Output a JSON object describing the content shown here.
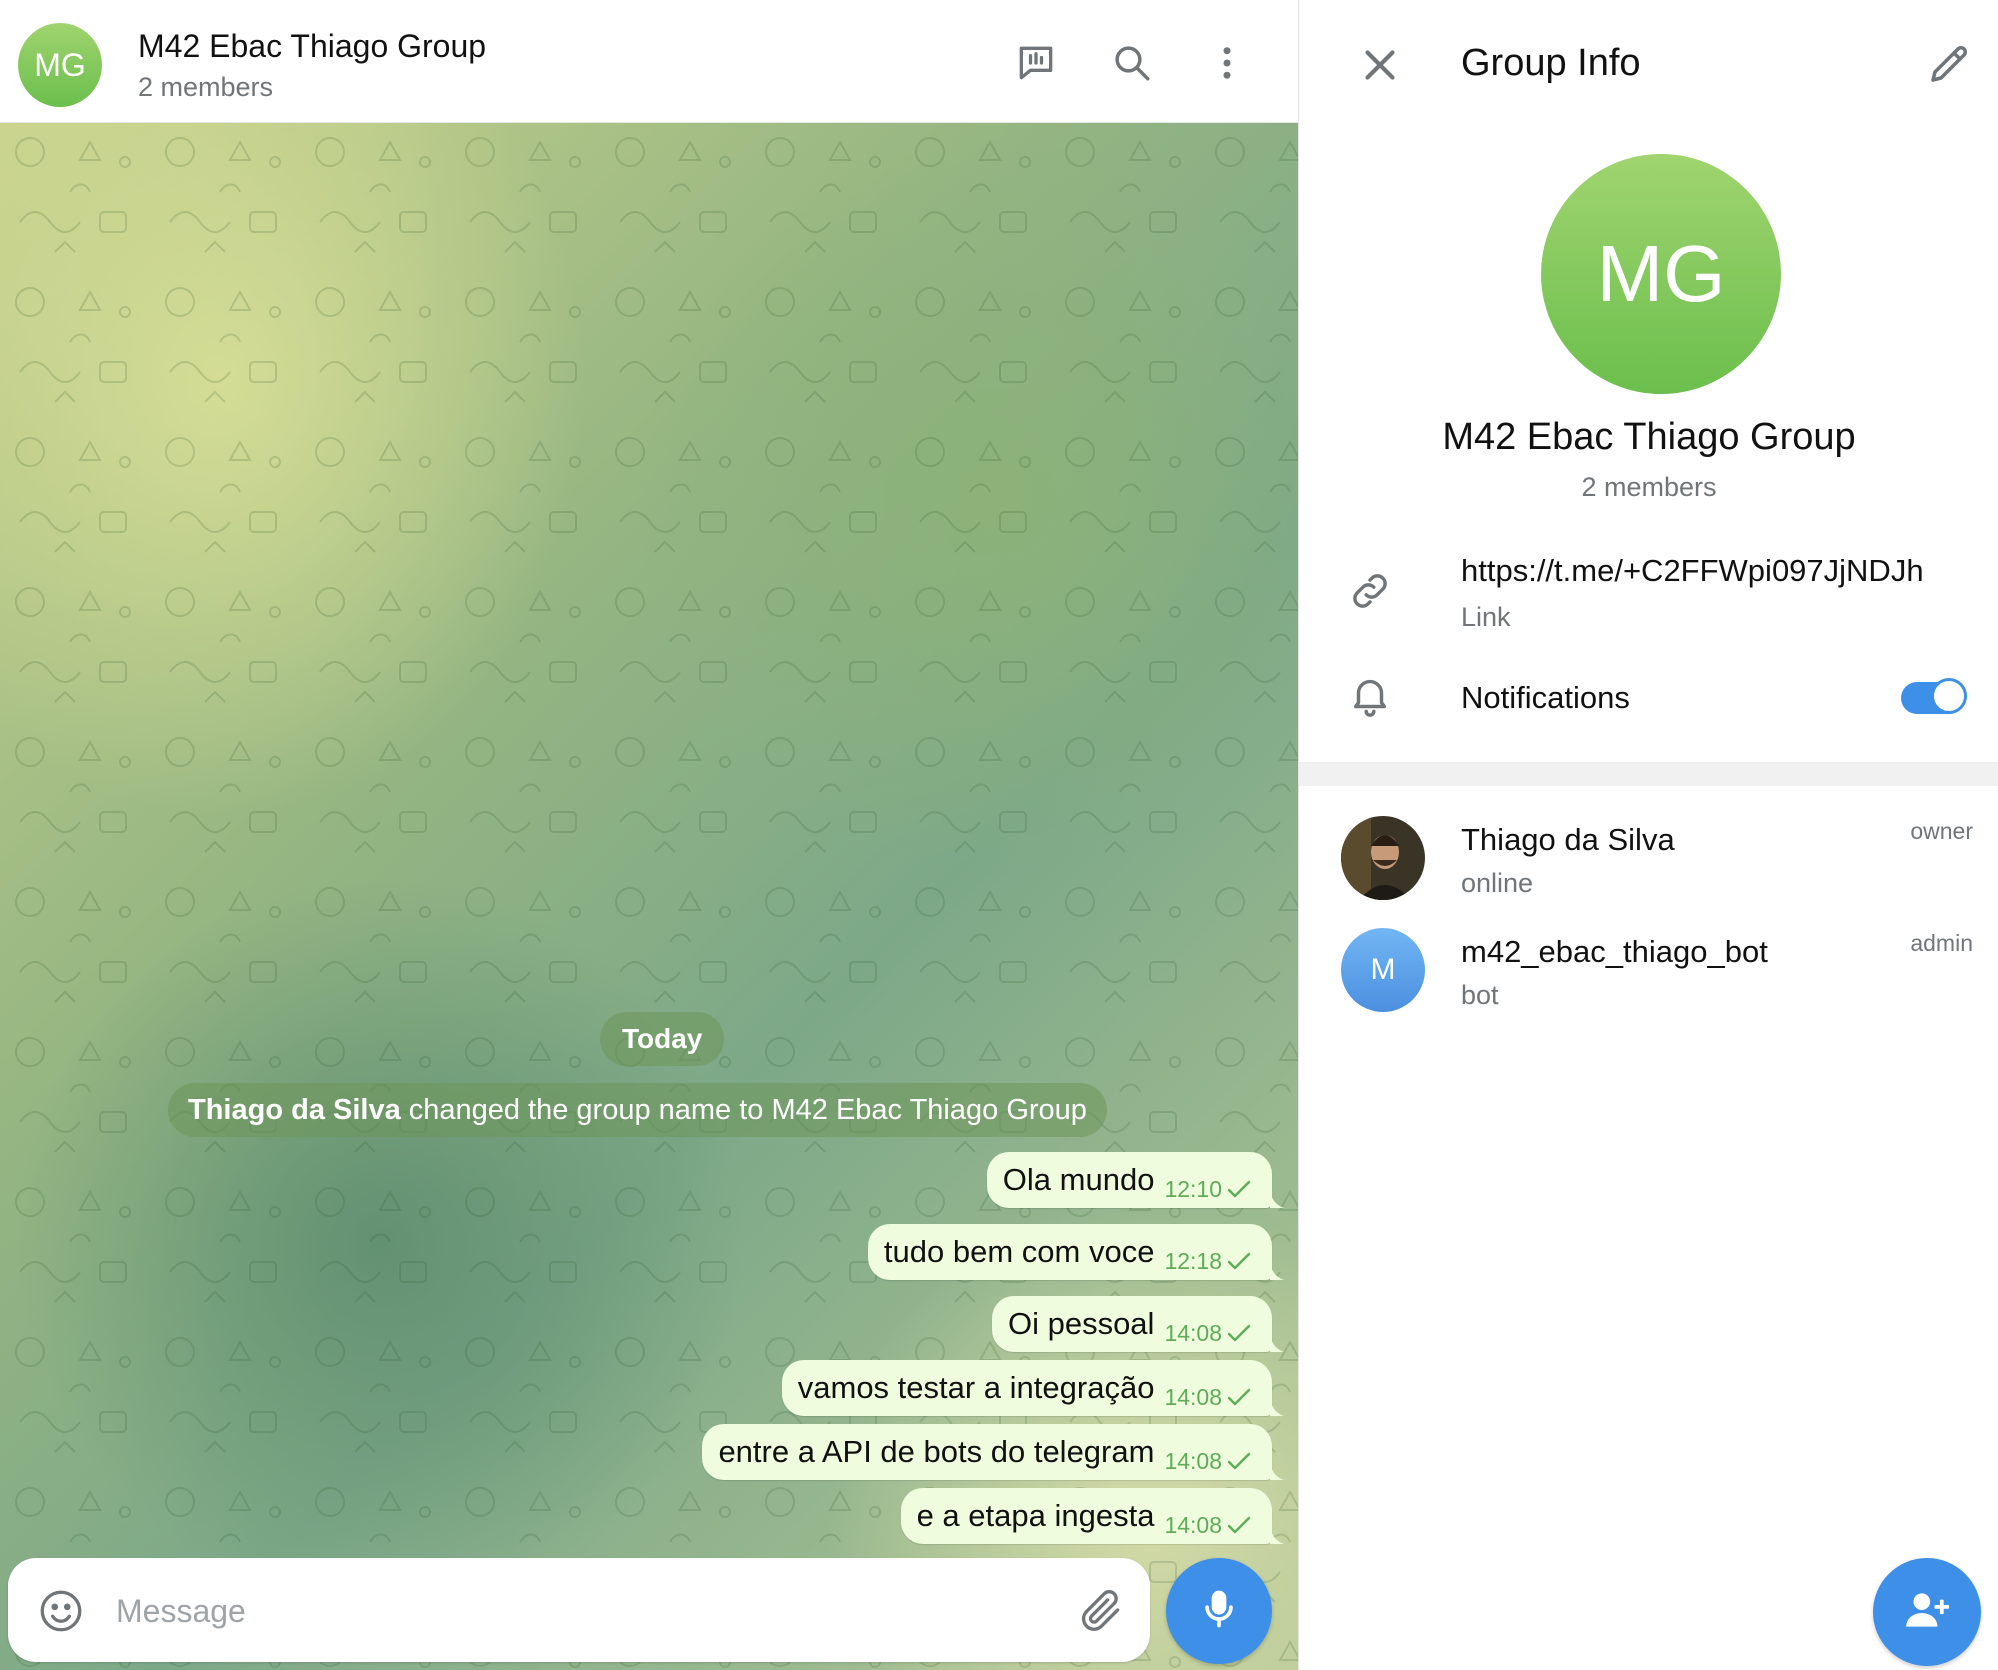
{
  "chat": {
    "avatar_initials": "MG",
    "title": "M42 Ebac Thiago Group",
    "subtitle": "2 members",
    "icons": [
      "stats-icon",
      "search-icon",
      "more-icon"
    ],
    "date_label": "Today",
    "service_actor": "Thiago da Silva",
    "service_text": "changed the group name to M42 Ebac Thiago Group",
    "messages": [
      {
        "text": "Ola mundo",
        "time": "12:10"
      },
      {
        "text": "tudo bem com voce",
        "time": "12:18"
      },
      {
        "text": "Oi pessoal",
        "time": "14:08"
      },
      {
        "text": "vamos testar a integração",
        "time": "14:08"
      },
      {
        "text": "entre a API de bots do telegram",
        "time": "14:08"
      },
      {
        "text": "e a etapa ingesta",
        "time": "14:08"
      }
    ],
    "composer": {
      "placeholder": "Message"
    }
  },
  "info": {
    "title": "Group Info",
    "avatar_initials": "MG",
    "name": "M42 Ebac Thiago Group",
    "subtitle": "2 members",
    "link_url": "https://t.me/+C2FFWpi097JjNDJh",
    "link_label": "Link",
    "notifications_label": "Notifications",
    "notifications_on": true,
    "members": [
      {
        "name": "Thiago da Silva",
        "status": "online",
        "role": "owner"
      },
      {
        "name": "m42_ebac_thiago_bot",
        "status": "bot",
        "role": "admin",
        "initial": "M"
      }
    ]
  },
  "colors": {
    "accent": "#3e8fe8",
    "bubble": "#effdde",
    "time": "#5fab57",
    "avatar_green": "#6bbf4d"
  }
}
